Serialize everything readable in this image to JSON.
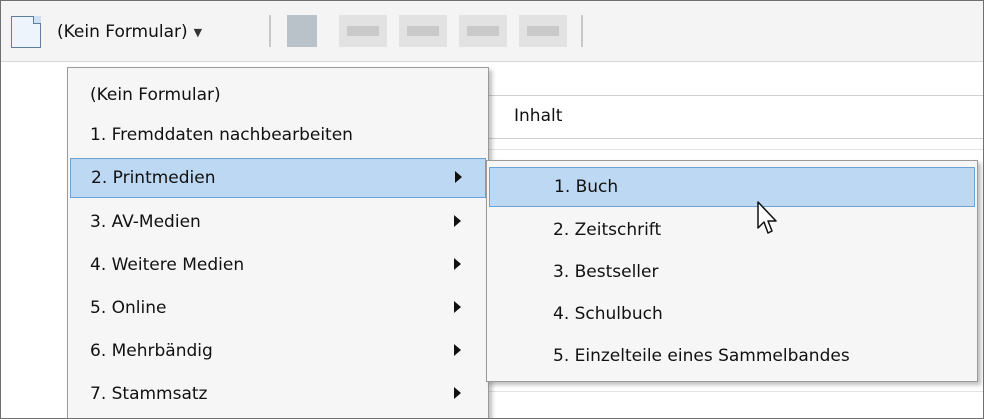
{
  "toolbar": {
    "form_selector_label": "(Kein Formular)",
    "form_selector_icon": "document-icon",
    "dropdown_icon": "chevron-down-icon"
  },
  "grid": {
    "column_header": "Inhalt"
  },
  "menu": {
    "items": [
      {
        "label": "(Kein Formular)",
        "has_submenu": false
      },
      {
        "label": "1. Fremddaten nachbearbeiten",
        "has_submenu": false
      },
      {
        "label": "2. Printmedien",
        "has_submenu": true,
        "selected": true
      },
      {
        "label": "3. AV-Medien",
        "has_submenu": true
      },
      {
        "label": "4. Weitere Medien",
        "has_submenu": true
      },
      {
        "label": "5. Online",
        "has_submenu": true
      },
      {
        "label": "6. Mehrbändig",
        "has_submenu": true
      },
      {
        "label": "7. Stammsatz",
        "has_submenu": true
      }
    ]
  },
  "submenu": {
    "items": [
      {
        "label": "1. Buch",
        "selected": true
      },
      {
        "label": "2. Zeitschrift"
      },
      {
        "label": "3. Bestseller"
      },
      {
        "label": "4. Schulbuch"
      },
      {
        "label": "5. Einzelteile eines Sammelbandes"
      }
    ]
  },
  "colors": {
    "selection_fill": "#bcd8f2",
    "selection_border": "#6ea2d2",
    "menu_background": "#f6f6f6"
  }
}
